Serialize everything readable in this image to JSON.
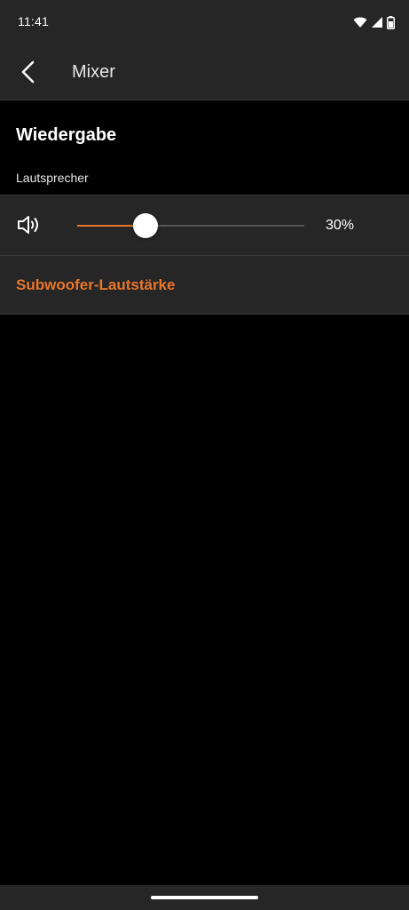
{
  "status_bar": {
    "time": "11:41",
    "icons": [
      "wifi-icon",
      "cell-signal-icon",
      "battery-icon"
    ]
  },
  "app_bar": {
    "back_icon": "back-arrow-icon",
    "title": "Mixer"
  },
  "playback": {
    "title": "Wiedergabe",
    "subtitle": "Lautsprecher",
    "volume": {
      "icon": "speaker-volume-icon",
      "value_percent": 30,
      "value_label": "30%"
    },
    "subwoofer_link": "Subwoofer-Lautstärke"
  },
  "colors": {
    "accent": "#e8762b",
    "surface": "#262626",
    "background": "#000000",
    "text": "#ffffff",
    "divider": "#3a3a3a"
  }
}
